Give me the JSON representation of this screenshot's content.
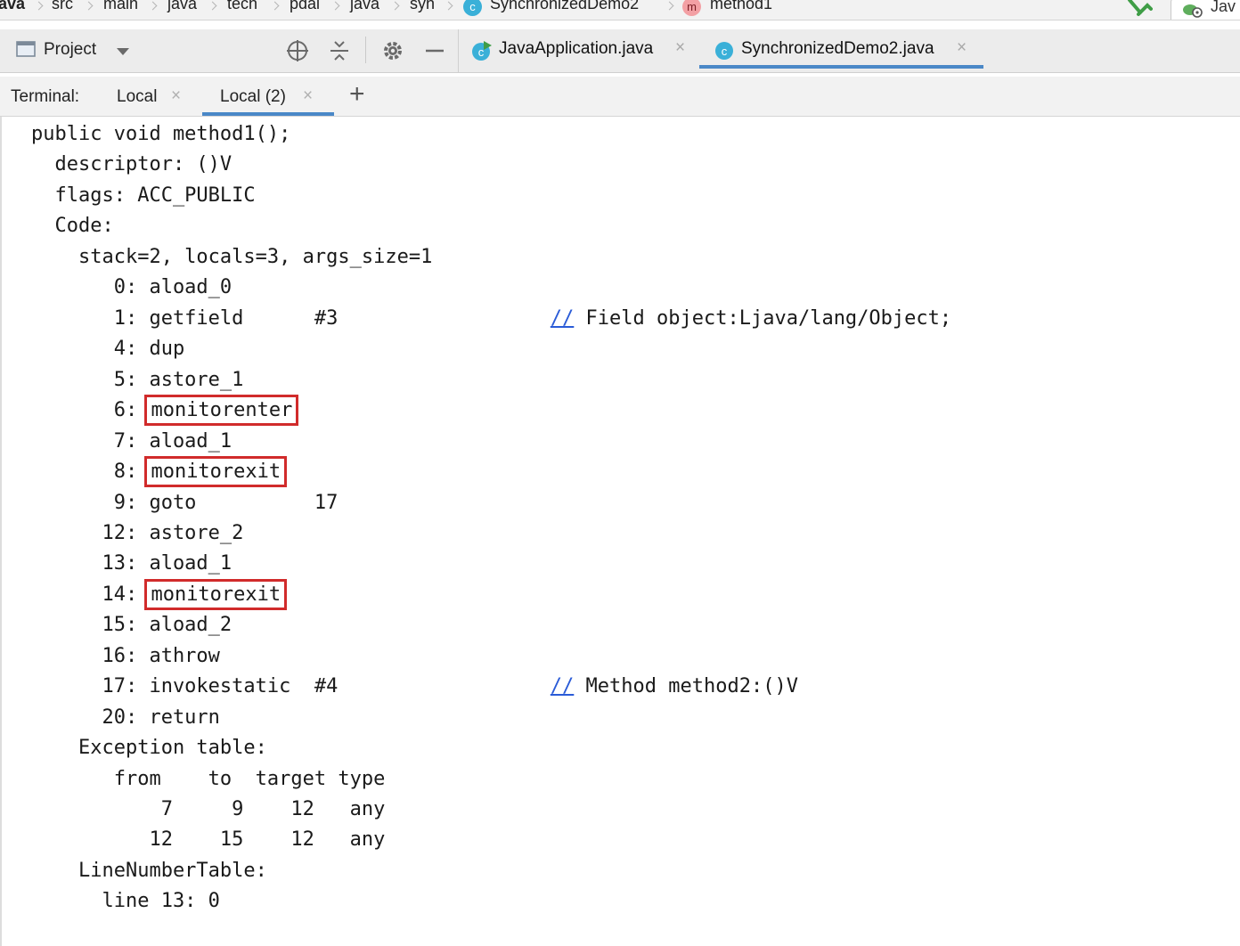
{
  "breadcrumb": {
    "items": [
      "ava",
      "src",
      "main",
      "java",
      "tech",
      "pdai",
      "java",
      "syn"
    ],
    "class_badge": "c",
    "class_name": "SynchronizedDemo2",
    "method_badge": "m",
    "method_name": "method1"
  },
  "run_config": {
    "label": "Jav"
  },
  "tool_window": {
    "title": "Project"
  },
  "editor_tabs": [
    {
      "label": "JavaApplication.java",
      "close": "×"
    },
    {
      "label": "SynchronizedDemo2.java",
      "close": "×"
    }
  ],
  "terminal": {
    "label": "Terminal:",
    "tabs": [
      {
        "label": "Local",
        "close": "×"
      },
      {
        "label": "Local (2)",
        "close": "×"
      }
    ],
    "add": "+"
  },
  "code": {
    "l0": "public void method1();",
    "l1": "  descriptor: ()V",
    "l2": "  flags: ACC_PUBLIC",
    "l3": "  Code:",
    "l4": "    stack=2, locals=3, args_size=1",
    "l5": "       0: aload_0",
    "l6_pre": "       1: getfield      #3                  ",
    "l6_slash": "//",
    "l6_post": " Field object:Ljava/lang/Object;",
    "l7": "       4: dup",
    "l8": "       5: astore_1",
    "l9_pre": "       6: ",
    "l9_hl": "monitorenter",
    "l10": "       7: aload_1",
    "l11_pre": "       8: ",
    "l11_hl": "monitorexit",
    "l12": "       9: goto          17",
    "l13": "      12: astore_2",
    "l14": "      13: aload_1",
    "l15_pre": "      14: ",
    "l15_hl": "monitorexit",
    "l16": "      15: aload_2",
    "l17": "      16: athrow",
    "l18_pre": "      17: invokestatic  #4                  ",
    "l18_slash": "//",
    "l18_post": " Method method2:()V",
    "l19": "      20: return",
    "l20": "    Exception table:",
    "l21": "       from    to  target type",
    "l22": "           7     9    12   any",
    "l23": "          12    15    12   any",
    "l24": "    LineNumberTable:",
    "l25": "      line 13: 0"
  },
  "colors": {
    "highlight_box": "#d12b2b",
    "tab_underline": "#4a88c7",
    "link_comment": "#2a5bd7"
  }
}
